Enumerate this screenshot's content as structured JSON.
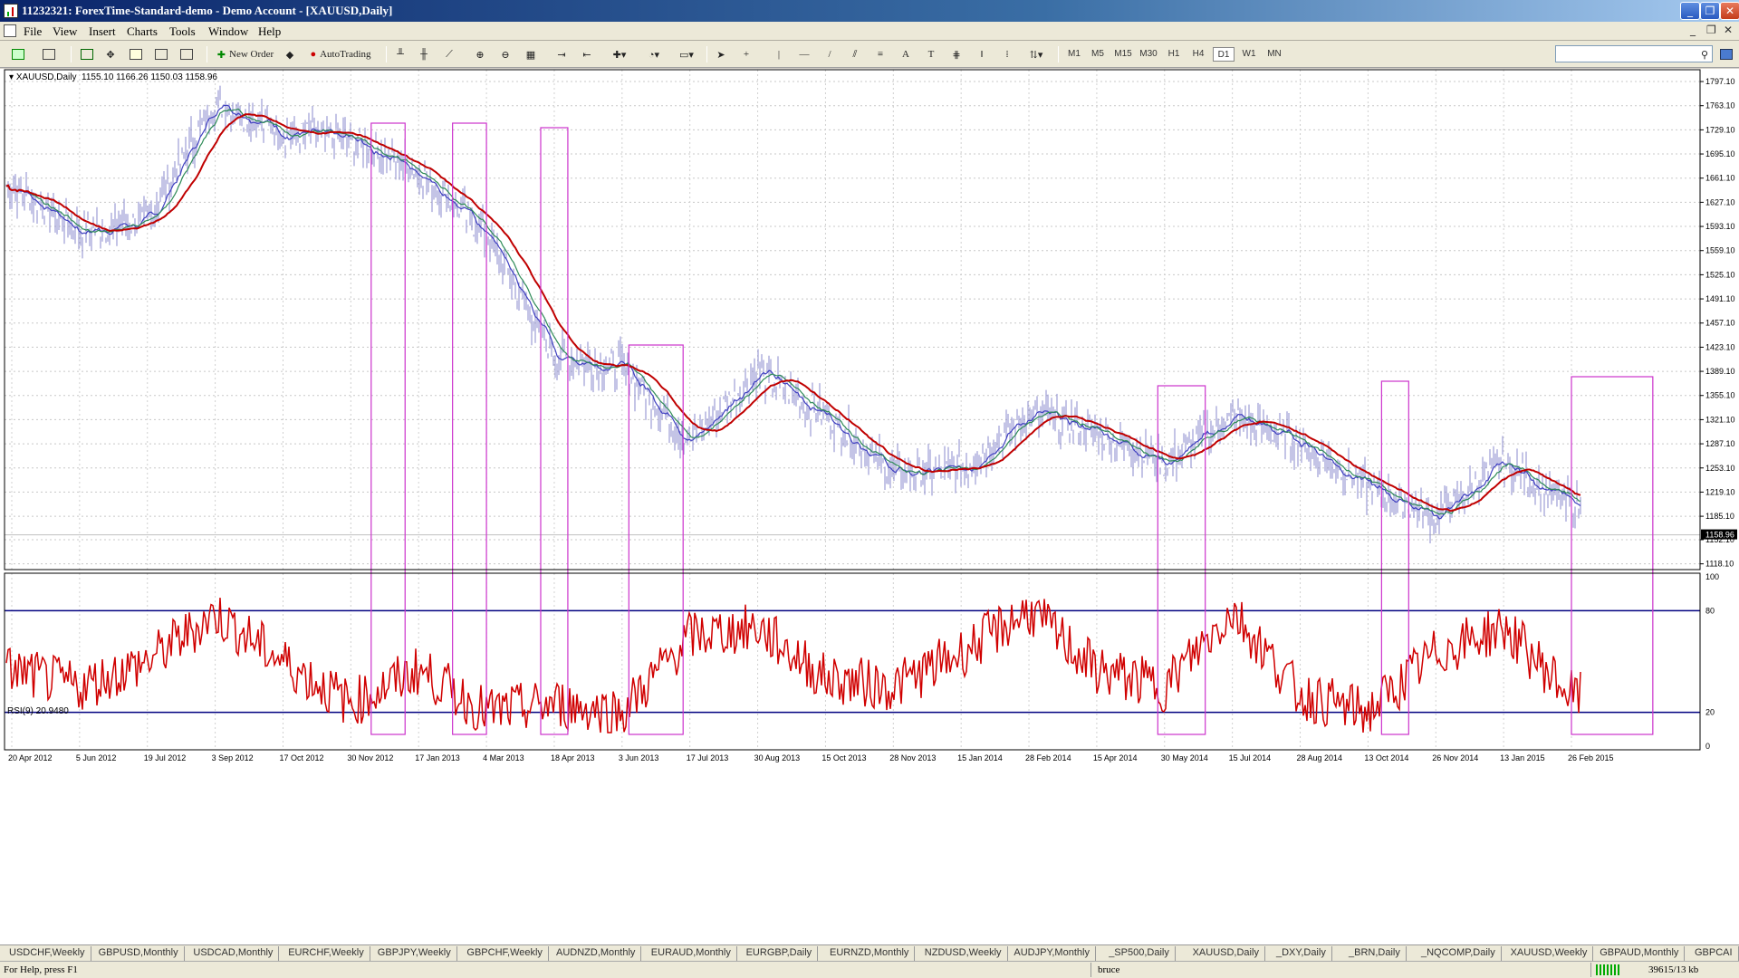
{
  "window": {
    "title": "11232321: ForexTime-Standard-demo - Demo Account - [XAUUSD,Daily]",
    "buttons": [
      "_",
      "❐",
      "✕"
    ]
  },
  "menu": [
    "File",
    "View",
    "Insert",
    "Charts",
    "Tools",
    "Window",
    "Help"
  ],
  "toolbar": {
    "new_order": "New Order",
    "autotrading": "AutoTrading",
    "timeframes": [
      "M1",
      "M5",
      "M15",
      "M30",
      "H1",
      "H4",
      "D1",
      "W1",
      "MN"
    ],
    "active_timeframe": "D1"
  },
  "chart": {
    "symbol_label": "XAUUSD,Daily",
    "ohlc": "1155.10 1166.26 1150.03 1158.96",
    "current_price": "1158.96",
    "price_axis": [
      "1797.10",
      "1763.10",
      "1729.10",
      "1695.10",
      "1661.10",
      "1627.10",
      "1593.10",
      "1559.10",
      "1525.10",
      "1491.10",
      "1457.10",
      "1423.10",
      "1389.10",
      "1355.10",
      "1321.10",
      "1287.10",
      "1253.10",
      "1219.10",
      "1185.10",
      "1152.10",
      "1118.10"
    ],
    "date_axis": [
      "20 Apr 2012",
      "5 Jun 2012",
      "19 Jul 2012",
      "3 Sep 2012",
      "17 Oct 2012",
      "30 Nov 2012",
      "17 Jan 2013",
      "4 Mar 2013",
      "18 Apr 2013",
      "3 Jun 2013",
      "17 Jul 2013",
      "30 Aug 2013",
      "15 Oct 2013",
      "28 Nov 2013",
      "15 Jan 2014",
      "28 Feb 2014",
      "15 Apr 2014",
      "30 May 2014",
      "15 Jul 2014",
      "28 Aug 2014",
      "13 Oct 2014",
      "26 Nov 2014",
      "13 Jan 2015",
      "26 Feb 2015"
    ],
    "indicator_label": "RSI(9) 20.9480",
    "rsi_axis": [
      "100",
      "80",
      "20",
      "0"
    ],
    "colors": {
      "price_bars": "#8888cc",
      "ma_slow": "#c00000",
      "ma_mid": "#2e8b57",
      "ma_fast": "#4040c0",
      "rsi_line": "#d00000",
      "rsi_levels": "#000080",
      "highlight_boxes": "#cc33cc"
    }
  },
  "chart_data": [
    {
      "type": "line",
      "title": "XAUUSD,Daily",
      "x": [
        "20 Apr 2012",
        "5 Jun 2012",
        "19 Jul 2012",
        "3 Sep 2012",
        "17 Oct 2012",
        "30 Nov 2012",
        "17 Jan 2013",
        "4 Mar 2013",
        "18 Apr 2013",
        "3 Jun 2013",
        "17 Jul 2013",
        "30 Aug 2013",
        "15 Oct 2013",
        "28 Nov 2013",
        "15 Jan 2014",
        "28 Feb 2014",
        "15 Apr 2014",
        "30 May 2014",
        "15 Jul 2014",
        "28 Aug 2014",
        "13 Oct 2014",
        "26 Nov 2014",
        "13 Jan 2015",
        "26 Feb 2015"
      ],
      "series": [
        {
          "values": [
            1650,
            1585,
            1600,
            1770,
            1725,
            1715,
            1670,
            1580,
            1410,
            1395,
            1290,
            1390,
            1325,
            1245,
            1250,
            1330,
            1305,
            1260,
            1325,
            1290,
            1225,
            1185,
            1260,
            1200
          ]
        }
      ],
      "ylim": [
        1110,
        1815
      ],
      "grid": true
    },
    {
      "type": "line",
      "title": "RSI(9) 20.9480",
      "x": [
        "20 Apr 2012",
        "5 Jun 2012",
        "19 Jul 2012",
        "3 Sep 2012",
        "17 Oct 2012",
        "30 Nov 2012",
        "17 Jan 2013",
        "4 Mar 2013",
        "18 Apr 2013",
        "3 Jun 2013",
        "17 Jul 2013",
        "30 Aug 2013",
        "15 Oct 2013",
        "28 Nov 2013",
        "15 Jan 2014",
        "28 Feb 2014",
        "15 Apr 2014",
        "30 May 2014",
        "15 Jul 2014",
        "28 Aug 2014",
        "13 Oct 2014",
        "26 Nov 2014",
        "13 Jan 2015",
        "26 Feb 2015"
      ],
      "series": [
        {
          "values": [
            45,
            35,
            50,
            78,
            50,
            25,
            45,
            20,
            25,
            20,
            65,
            70,
            40,
            35,
            55,
            80,
            45,
            35,
            80,
            30,
            20,
            55,
            70,
            30
          ]
        }
      ],
      "ylim": [
        0,
        100
      ],
      "levels": [
        80,
        20
      ]
    }
  ],
  "symbol_tabs": [
    "USDCHF,Weekly",
    "GBPUSD,Monthly",
    "USDCAD,Monthly",
    "EURCHF,Weekly",
    "GBPJPY,Weekly",
    "GBPCHF,Weekly",
    "AUDNZD,Monthly",
    "EURAUD,Monthly",
    "EURGBP,Daily",
    "EURNZD,Monthly",
    "NZDUSD,Weekly",
    "AUDJPY,Monthly",
    "_SP500,Daily",
    "XAUUSD,Daily",
    "_DXY,Daily",
    "_BRN,Daily",
    "_NQCOMP,Daily",
    "XAUUSD,Weekly",
    "GBPAUD,Monthly",
    "GBPCAI"
  ],
  "status": {
    "help": "For Help, press F1",
    "profile": "bruce",
    "traffic": "39615/13 kb"
  }
}
